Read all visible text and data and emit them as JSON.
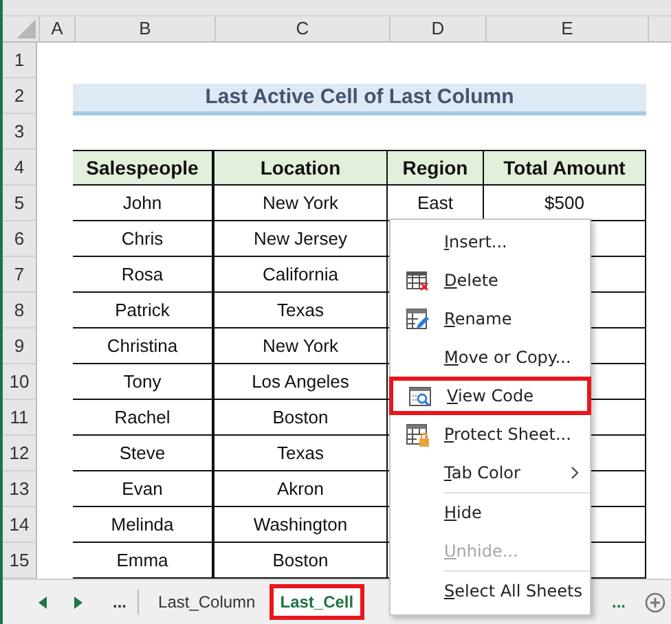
{
  "columns": [
    "A",
    "B",
    "C",
    "D",
    "E"
  ],
  "row_numbers": [
    "1",
    "2",
    "3",
    "4",
    "5",
    "6",
    "7",
    "8",
    "9",
    "10",
    "11",
    "12",
    "13",
    "14",
    "15"
  ],
  "title": "Last Active Cell of Last Column",
  "table": {
    "columns": [
      "Salespeople",
      "Location",
      "Region",
      "Total Amount"
    ],
    "rows": [
      {
        "salesperson": "John",
        "location": "New York",
        "region": "East",
        "amount": "$500"
      },
      {
        "salesperson": "Chris",
        "location": "New Jersey"
      },
      {
        "salesperson": "Rosa",
        "location": "California"
      },
      {
        "salesperson": "Patrick",
        "location": "Texas"
      },
      {
        "salesperson": "Christina",
        "location": "New York"
      },
      {
        "salesperson": "Tony",
        "location": "Los Angeles"
      },
      {
        "salesperson": "Rachel",
        "location": "Boston"
      },
      {
        "salesperson": "Steve",
        "location": "Texas"
      },
      {
        "salesperson": "Evan",
        "location": "Akron"
      },
      {
        "salesperson": "Melinda",
        "location": "Washington"
      },
      {
        "salesperson": "Emma",
        "location": "Boston"
      }
    ]
  },
  "context_menu": {
    "items": [
      {
        "label": "Insert...",
        "kind": "plain",
        "selected": false,
        "disabled": false
      },
      {
        "label": "Delete",
        "kind": "delete",
        "selected": false,
        "disabled": false
      },
      {
        "label": "Rename",
        "kind": "rename",
        "selected": false,
        "disabled": false
      },
      {
        "label": "Move or Copy...",
        "kind": "plain",
        "selected": false,
        "disabled": false
      },
      {
        "label": "View Code",
        "kind": "code",
        "selected": true,
        "disabled": false
      },
      {
        "label": "Protect Sheet...",
        "kind": "protect",
        "selected": false,
        "disabled": false
      },
      {
        "label": "Tab Color",
        "kind": "plain",
        "submenu": true,
        "selected": false,
        "disabled": false,
        "separator_after": true
      },
      {
        "label": "Hide",
        "kind": "plain",
        "selected": false,
        "disabled": false
      },
      {
        "label": "Unhide...",
        "kind": "plain",
        "selected": false,
        "disabled": true,
        "separator_after": true
      },
      {
        "label": "Select All Sheets",
        "kind": "plain",
        "selected": false,
        "disabled": false
      }
    ]
  },
  "sheet_tabs": {
    "overflow_left": "...",
    "tabs": [
      {
        "label": "Last_Column",
        "selected": false
      },
      {
        "label": "Last_Cell",
        "selected": true
      }
    ],
    "overflow_right": "..."
  }
}
